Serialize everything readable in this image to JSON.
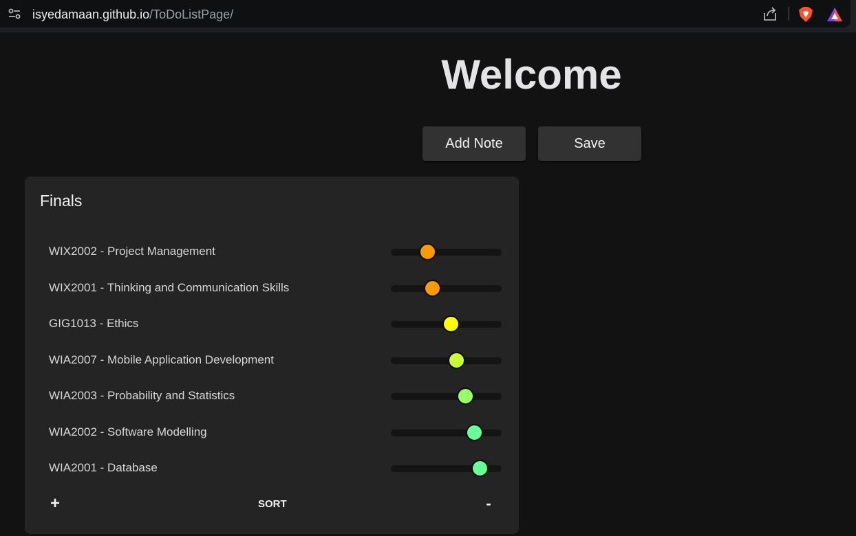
{
  "browser": {
    "url_domain": "isyedamaan.github.io",
    "url_path": "/ToDoListPage/",
    "icons": [
      "site-settings-icon",
      "share-icon",
      "brave-shields-icon",
      "brave-rewards-icon"
    ]
  },
  "page": {
    "title": "Welcome",
    "add_note_label": "Add Note",
    "save_label": "Save"
  },
  "note": {
    "title": "Finals",
    "items": [
      {
        "label": "WIX2002 - Project Management",
        "progress": 0.33,
        "color": "#ff9900"
      },
      {
        "label": "WIX2001 - Thinking and Communication Skills",
        "progress": 0.37,
        "color": "#ff9900"
      },
      {
        "label": "GIG1013 - Ethics",
        "progress": 0.54,
        "color": "#ffff00"
      },
      {
        "label": "WIA2007 - Mobile Application Development",
        "progress": 0.59,
        "color": "#ccff33"
      },
      {
        "label": "WIA2003 - Probability and Statistics",
        "progress": 0.67,
        "color": "#99ff66"
      },
      {
        "label": "WIA2002 - Software Modelling",
        "progress": 0.75,
        "color": "#66ff99"
      },
      {
        "label": "WIA2001 - Database",
        "progress": 0.8,
        "color": "#66ff99"
      }
    ],
    "add_label": "+",
    "sort_label": "SORT",
    "remove_label": "-"
  }
}
